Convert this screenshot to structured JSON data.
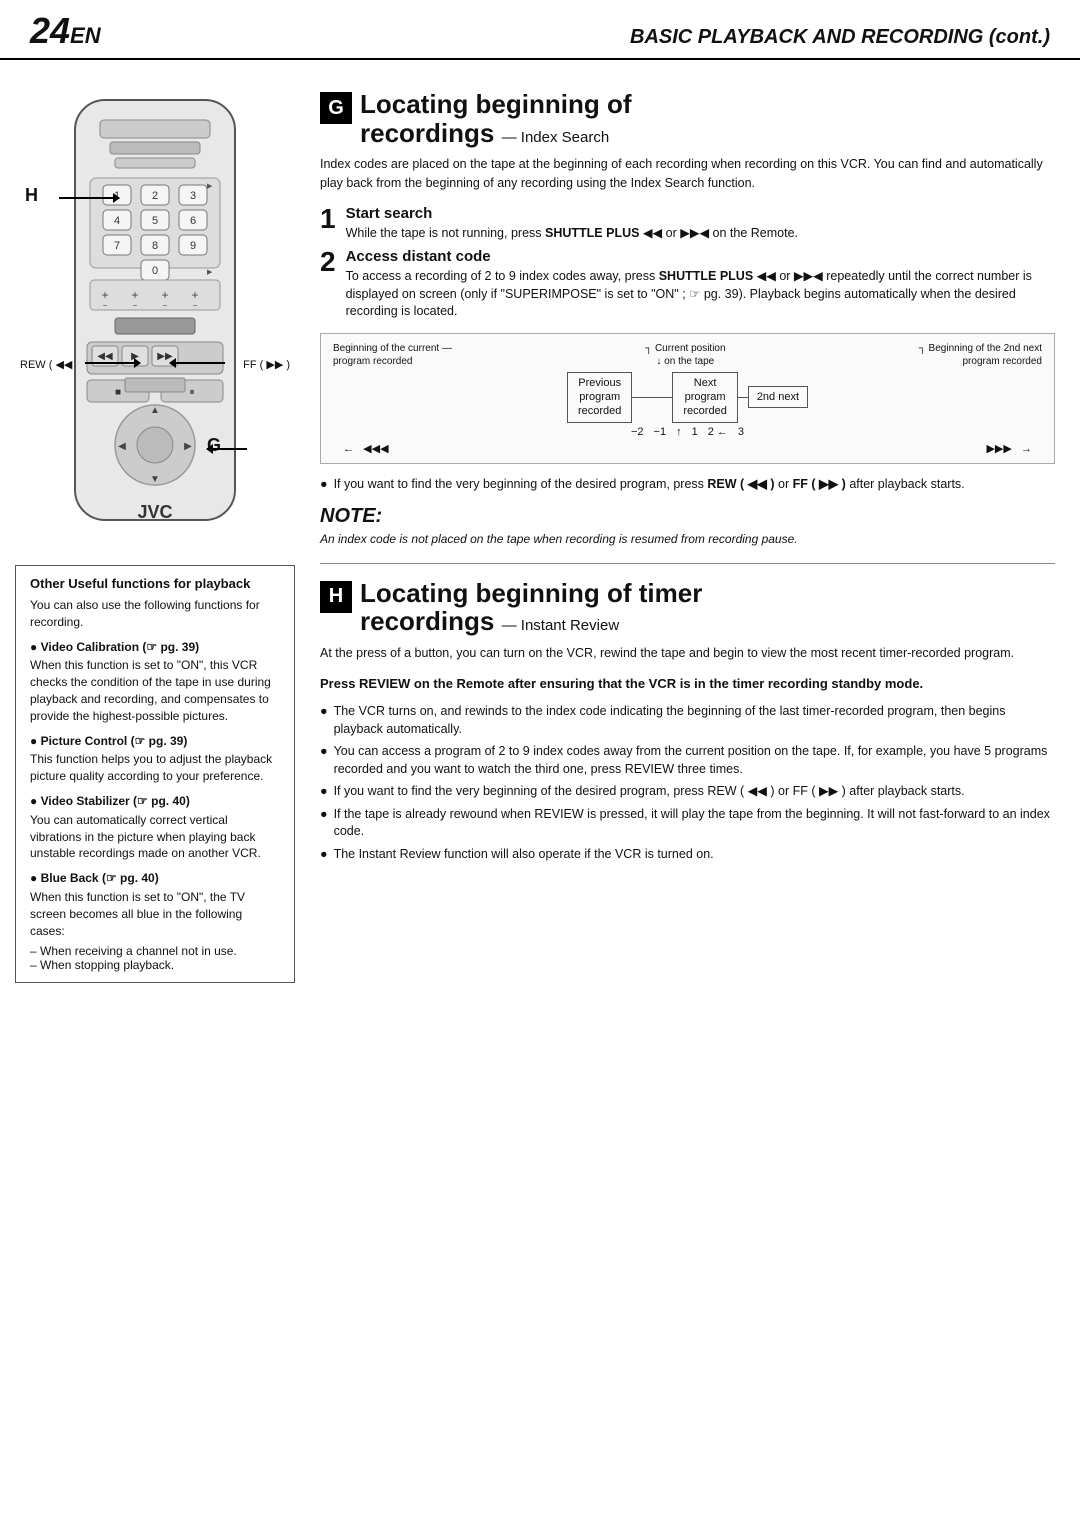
{
  "header": {
    "page_number": "24",
    "page_suffix": "EN",
    "page_title": "BASIC PLAYBACK AND RECORDING (cont.)"
  },
  "section_g": {
    "letter": "G",
    "title_line1": "Locating beginning of",
    "title_line2": "recordings",
    "subtitle": "— Index Search",
    "intro": "Index codes are placed on the tape at the beginning of each recording when recording on this VCR. You can find and automatically play back from the beginning of any recording using the Index Search function.",
    "step1_number": "1",
    "step1_title": "Start search",
    "step1_text": "While the tape is not running, press SHUTTLE PLUS ◀◀ or ▶▶◀ on the Remote.",
    "step2_number": "2",
    "step2_title": "Access distant code",
    "step2_text": "To access a recording of 2 to 9 index codes away, press SHUTTLE PLUS ◀◀ or ▶▶◀ repeatedly until the correct number is displayed on screen (only if \"SUPERIMPOSE\" is set to \"ON\" ; ☞ pg. 39). Playback begins automatically when the desired recording is located.",
    "diagram": {
      "label1": "Beginning of the current\nprogram recorded",
      "label2": "Current position\non the tape",
      "label3": "Beginning of the 2nd next\nprogram recorded",
      "box1": "Previous\nprogram\nrecorded",
      "box2": "Next\nprogram\nrecorded",
      "box3": "2nd next",
      "num_minus2": "−2",
      "num_minus1": "−1",
      "num_1": "1",
      "num_2": "2",
      "num_3": "3",
      "arrow_left": "◀",
      "arrow_rew": "◀◀◀",
      "arrow_ff": "▶▶▶",
      "arrow_right": "▶"
    },
    "bullet1": "If you want to find the very beginning of the desired program, press REW ( ◀◀ ) or FF ( ▶▶ ) after playback starts.",
    "note_title": "NOTE:",
    "note_text": "An index code is not placed on the tape when recording is resumed from recording pause."
  },
  "section_h": {
    "letter": "H",
    "title_line1": "Locating beginning of timer",
    "title_line2": "recordings",
    "subtitle": "— Instant Review",
    "intro": "At the press of a button, you can turn on the VCR, rewind the tape and begin to view the most recent timer-recorded program.",
    "press_note_bold": "Press REVIEW on the Remote after ensuring that the VCR is in the timer recording standby mode.",
    "bullets": [
      "The VCR turns on, and rewinds to the index code indicating the beginning of the last timer-recorded program, then begins playback automatically.",
      "You can access a program of 2 to 9 index codes away from the current position on the tape. If, for example, you have 5 programs recorded and you want to watch the third one, press REVIEW three times.",
      "If you want to find the very beginning of the desired program, press REW ( ◀◀ ) or FF ( ▶▶ ) after playback starts.",
      "If the tape is already rewound when REVIEW is pressed, it will play the tape from the beginning. It will not fast-forward to an index code.",
      "The Instant Review function will also operate if the VCR is turned on."
    ]
  },
  "sidebar": {
    "title": "Other Useful functions for playback",
    "intro": "You can also use the following functions for recording.",
    "item1_title": "● Video Calibration (☞ pg. 39)",
    "item1_text": "When this function is set to \"ON\", this VCR checks the condition of the tape in use during playback and recording, and compensates to provide the highest-possible pictures.",
    "item2_title": "● Picture Control (☞ pg. 39)",
    "item2_text": "This function helps you to adjust the playback picture quality according to your preference.",
    "item3_title": "● Video Stabilizer (☞ pg. 40)",
    "item3_text": "You can automatically correct vertical vibrations in the picture when playing back unstable recordings made on another VCR.",
    "item4_title": "● Blue Back (☞ pg. 40)",
    "item4_text": "When this function is set to \"ON\", the TV screen becomes all blue in the following cases:",
    "item4_bullets": [
      "When receiving a channel not in use.",
      "When stopping playback."
    ]
  },
  "remote": {
    "label_h": "H",
    "label_g": "G",
    "label_rew": "REW ( ◀◀",
    "label_ff": "FF ( ▶▶ )",
    "brand": "JVC"
  }
}
